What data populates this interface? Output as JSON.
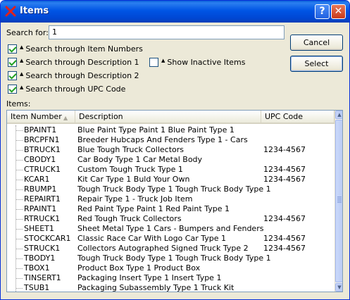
{
  "window": {
    "title": "Items",
    "help_glyph": "?",
    "close_glyph": "✕",
    "colors": {
      "titlebar": "#0055e5",
      "face": "#ece9d8",
      "check": "#21a121"
    }
  },
  "search": {
    "label": "Search for:",
    "value": "1"
  },
  "options": [
    {
      "label": "Search through Item Numbers",
      "checked": true
    },
    {
      "label": "Search through Description 1",
      "checked": true
    },
    {
      "label": "Search through Description 2",
      "checked": true
    },
    {
      "label": "Search through UPC Code",
      "checked": true
    }
  ],
  "inactive": {
    "label": "Show Inactive Items",
    "checked": false
  },
  "buttons": {
    "cancel": "Cancel",
    "select": "Select"
  },
  "list": {
    "label": "Items:",
    "columns": [
      "Item Number",
      "Description",
      "UPC Code"
    ],
    "sorted_column": "Item Number",
    "rows": [
      {
        "item": "BPAINT1",
        "desc": "Blue Paint Type Paint 1 Blue Paint Type 1",
        "upc": ""
      },
      {
        "item": "BRCPFN1",
        "desc": "Breeder Hubcaps And Fenders Type 1 - Cars",
        "upc": ""
      },
      {
        "item": "BTRUCK1",
        "desc": "Blue Tough Truck Collectors",
        "upc": "1234-4567"
      },
      {
        "item": "CBODY1",
        "desc": "Car Body Type 1 Car Metal Body",
        "upc": ""
      },
      {
        "item": "CTRUCK1",
        "desc": "Custom Tough Truck Type 1",
        "upc": "1234-4567"
      },
      {
        "item": "KCAR1",
        "desc": "Kit Car Type 1 Buld Your Own",
        "upc": "1234-4567"
      },
      {
        "item": "RBUMP1",
        "desc": "Tough Truck Body Type 1 Tough Truck Body Type 1",
        "upc": ""
      },
      {
        "item": "REPAIRT1",
        "desc": "Repair Type 1 - Truck  Job Item",
        "upc": ""
      },
      {
        "item": "RPAINT1",
        "desc": "Red Paint Type Paint 1 Red Paint Type 1",
        "upc": ""
      },
      {
        "item": "RTRUCK1",
        "desc": "Red Tough Truck Collectors",
        "upc": "1234-4567"
      },
      {
        "item": "SHEET1",
        "desc": "Sheet Metal Type 1 Cars - Bumpers and Fenders",
        "upc": ""
      },
      {
        "item": "STOCKCAR1",
        "desc": "Classic Race Car With Logo Car Type 1",
        "upc": "1234-4567"
      },
      {
        "item": "STRUCK1",
        "desc": "Collectors Autographed Signed Truck Type 2",
        "upc": "1234-4567"
      },
      {
        "item": "TBODY1",
        "desc": "Tough Truck Body Type 1 Tough Truck Body Type 1",
        "upc": ""
      },
      {
        "item": "TBOX1",
        "desc": "Product Box Type 1 Product Box",
        "upc": ""
      },
      {
        "item": "TINSERT1",
        "desc": "Packaging Insert Type 1 Insert Type 1",
        "upc": ""
      },
      {
        "item": "TSUB1",
        "desc": "Packaging Subassembly Type 1 Truck Kit",
        "upc": ""
      }
    ]
  }
}
